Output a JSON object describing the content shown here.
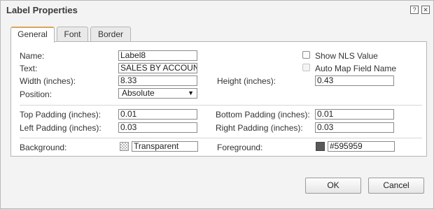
{
  "window": {
    "title": "Label Properties",
    "help_glyph": "?",
    "close_glyph": "✕"
  },
  "tabs": [
    {
      "label": "General",
      "active": true
    },
    {
      "label": "Font",
      "active": false
    },
    {
      "label": "Border",
      "active": false
    }
  ],
  "general": {
    "name_label": "Name:",
    "name_value": "Label8",
    "text_label": "Text:",
    "text_value": "SALES BY ACCOUNT",
    "width_label": "Width (inches):",
    "width_value": "8.33",
    "height_label": "Height (inches):",
    "height_value": "0.43",
    "position_label": "Position:",
    "position_value": "Absolute",
    "show_nls_label": "Show NLS Value",
    "show_nls_checked": false,
    "auto_map_label": "Auto Map Field Name",
    "auto_map_checked": false,
    "auto_map_disabled": true,
    "top_padding_label": "Top Padding (inches):",
    "top_padding_value": "0.01",
    "bottom_padding_label": "Bottom Padding (inches):",
    "bottom_padding_value": "0.01",
    "left_padding_label": "Left Padding (inches):",
    "left_padding_value": "0.03",
    "right_padding_label": "Right Padding (inches):",
    "right_padding_value": "0.03",
    "background_label": "Background:",
    "background_value": "Transparent",
    "foreground_label": "Foreground:",
    "foreground_value": "#595959"
  },
  "colors": {
    "accent_tab": "#f0a22d",
    "foreground_swatch": "#595959"
  },
  "buttons": {
    "ok": "OK",
    "cancel": "Cancel"
  }
}
